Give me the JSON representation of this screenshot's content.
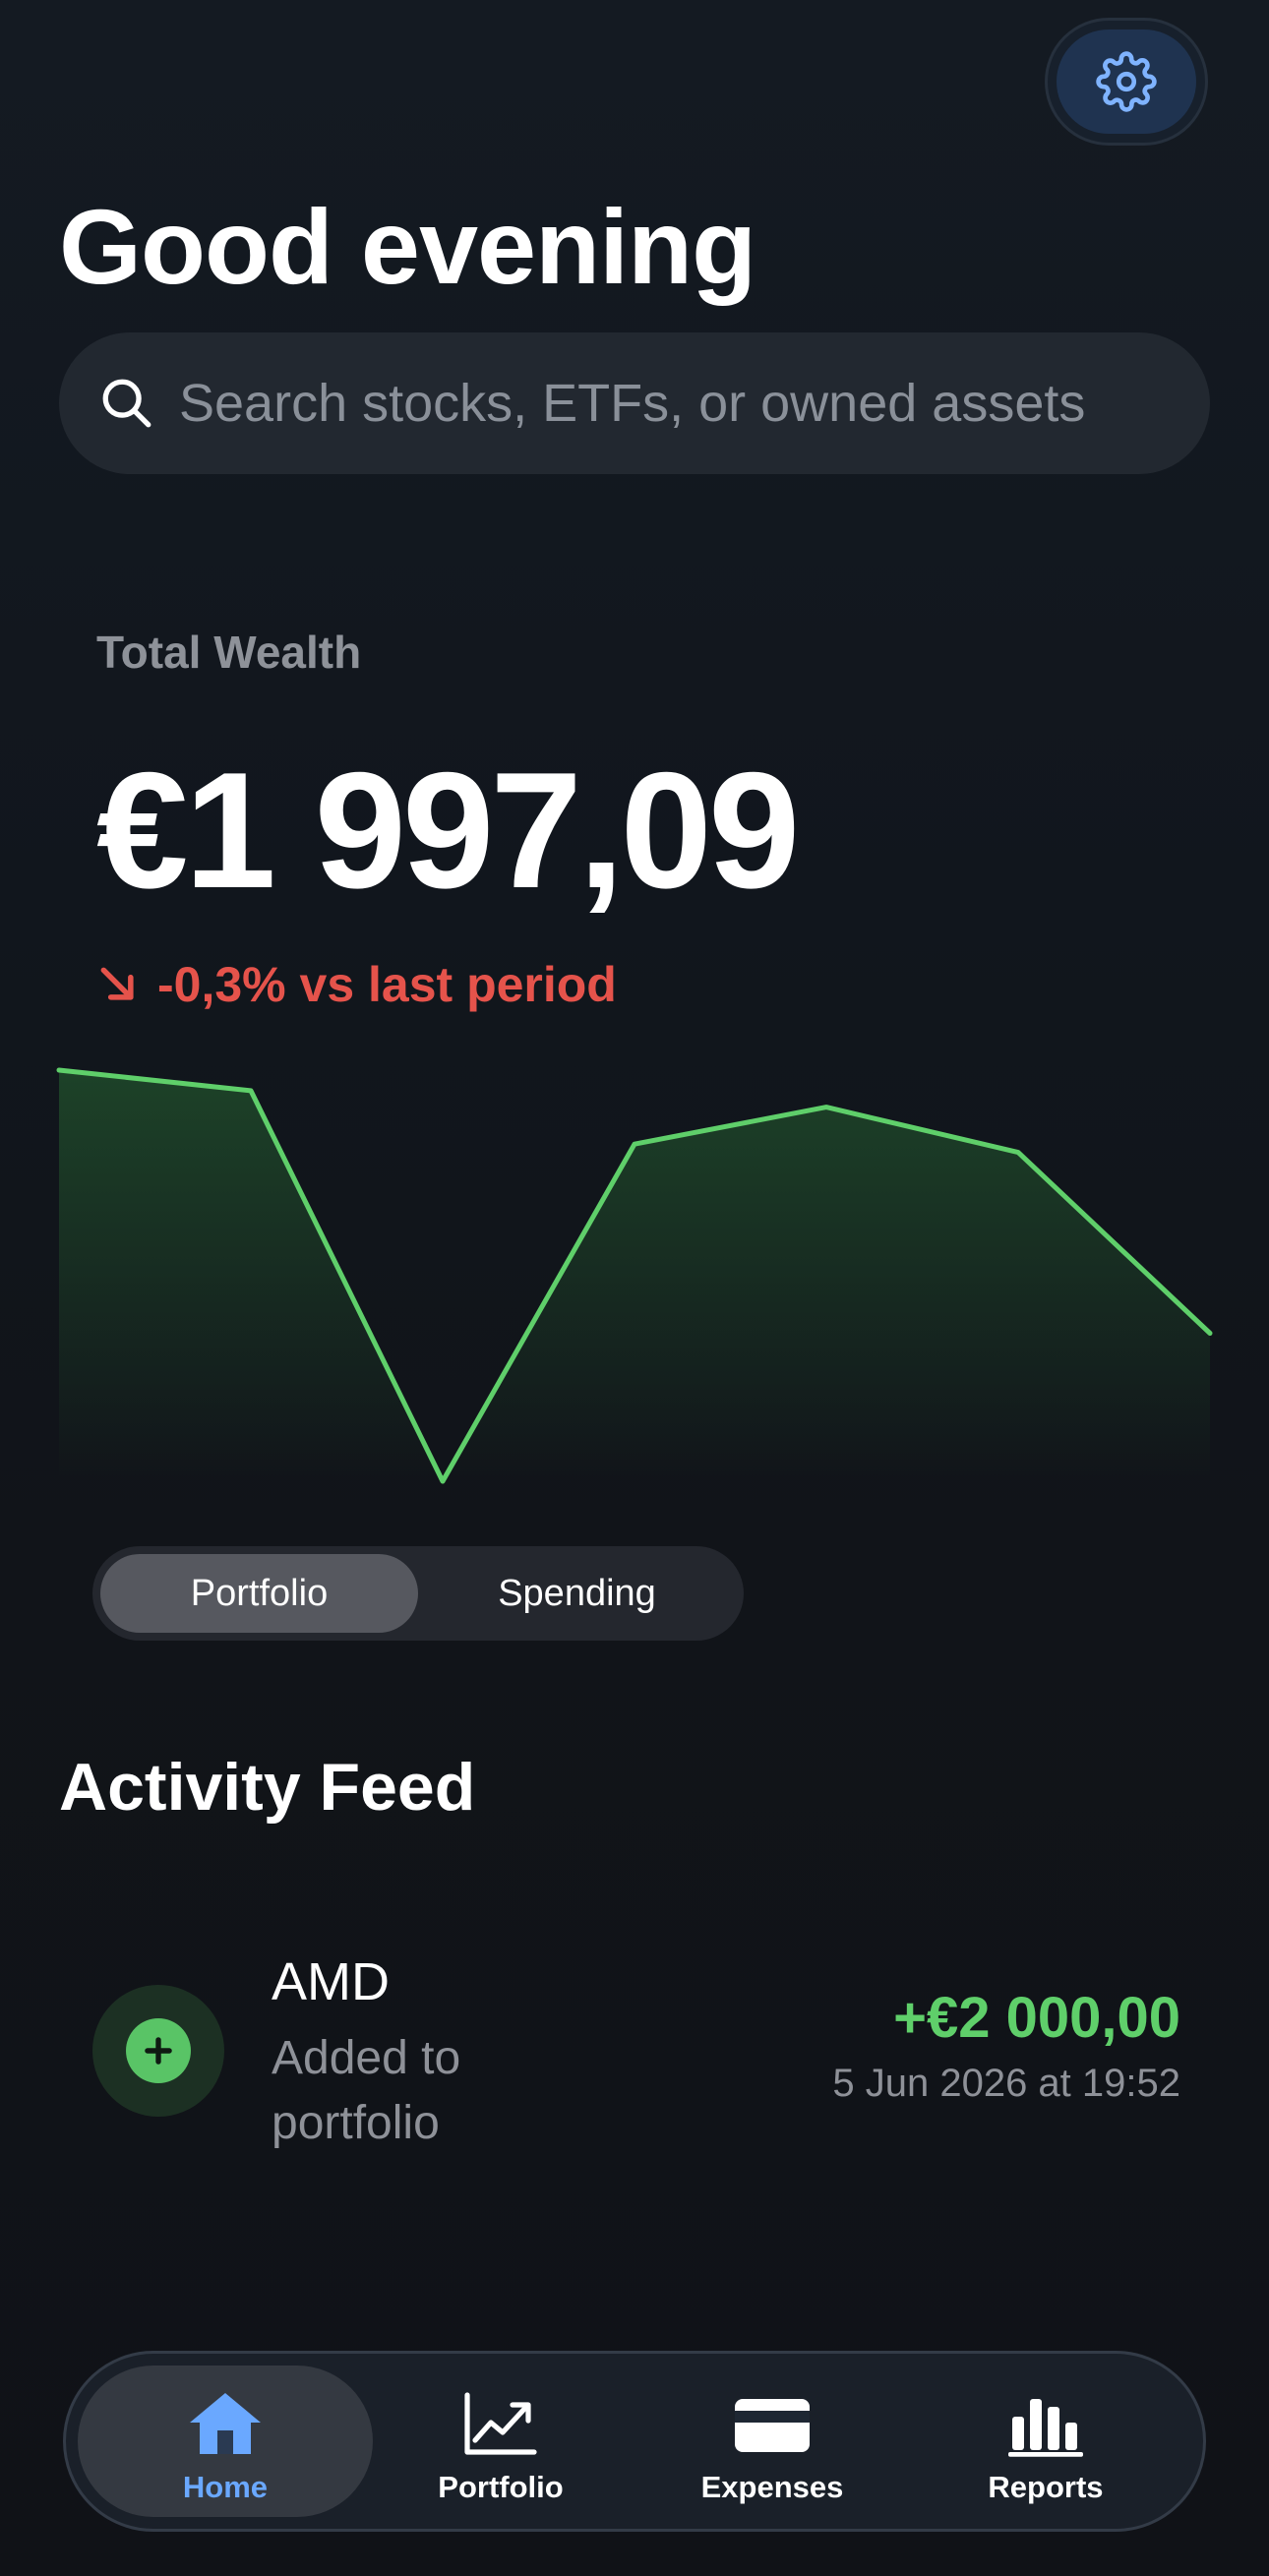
{
  "header": {
    "greeting": "Good evening",
    "settings_icon": "gear-icon"
  },
  "search": {
    "placeholder": "Search stocks, ETFs, or owned assets",
    "icon": "search-icon"
  },
  "wealth": {
    "label": "Total Wealth",
    "value": "€1 997,09",
    "change": "-0,3% vs last period",
    "change_direction": "down",
    "change_color": "#e5534b"
  },
  "chart_data": {
    "type": "area",
    "x": [
      0,
      1,
      2,
      3,
      4,
      5,
      6
    ],
    "values": [
      1.0,
      0.95,
      0.0,
      0.82,
      0.91,
      0.8,
      0.36
    ],
    "line_color": "#5fcf6a",
    "fill_color": "#1f4a2a",
    "grid": false,
    "title": "",
    "xlabel": "",
    "ylabel": ""
  },
  "segmented": {
    "options": [
      "Portfolio",
      "Spending"
    ],
    "selected": "Portfolio"
  },
  "feed": {
    "title": "Activity Feed",
    "items": [
      {
        "asset": "AMD",
        "description": "Added to portfolio",
        "amount": "+€2 000,00",
        "date": "5 Jun 2026 at 19:52",
        "icon": "plus-icon",
        "amount_color": "#5fcf6a"
      }
    ]
  },
  "tabbar": {
    "tabs": [
      {
        "label": "Home",
        "icon": "home-icon",
        "active": true
      },
      {
        "label": "Portfolio",
        "icon": "chart-line-icon",
        "active": false
      },
      {
        "label": "Expenses",
        "icon": "card-icon",
        "active": false
      },
      {
        "label": "Reports",
        "icon": "bar-chart-icon",
        "active": false
      }
    ],
    "active_color": "#6aa8ff"
  }
}
